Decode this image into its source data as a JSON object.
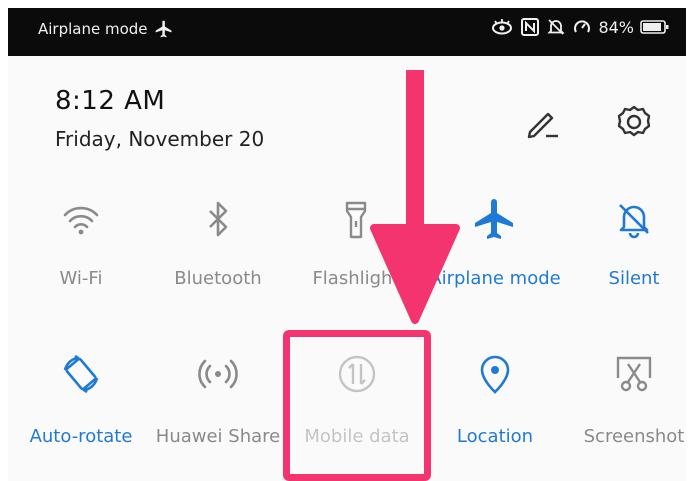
{
  "status_bar": {
    "airplane_mode_label": "Airplane mode",
    "battery_percent": "84%"
  },
  "header": {
    "time": "8:12 AM",
    "date": "Friday, November 20"
  },
  "toggles": [
    {
      "label": "Wi-Fi",
      "state": "off",
      "icon": "wifi-icon"
    },
    {
      "label": "Bluetooth",
      "state": "off",
      "icon": "bluetooth-icon"
    },
    {
      "label": "Flashlight",
      "state": "off",
      "icon": "flashlight-icon"
    },
    {
      "label": "Airplane mode",
      "state": "on",
      "icon": "airplane-icon"
    },
    {
      "label": "Silent",
      "state": "on",
      "icon": "silent-bell-icon"
    },
    {
      "label": "Auto-rotate",
      "state": "on",
      "icon": "auto-rotate-icon"
    },
    {
      "label": "Huawei Share",
      "state": "off",
      "icon": "huawei-share-icon"
    },
    {
      "label": "Mobile data",
      "state": "disabled",
      "icon": "mobile-data-icon"
    },
    {
      "label": "Location",
      "state": "on",
      "icon": "location-pin-icon"
    },
    {
      "label": "Screenshot",
      "state": "off",
      "icon": "screenshot-icon"
    }
  ],
  "colors": {
    "active": "#1f7ad6",
    "inactive": "#8a8a8a",
    "disabled": "#c4c4c4",
    "annotation": "#f4346f"
  }
}
